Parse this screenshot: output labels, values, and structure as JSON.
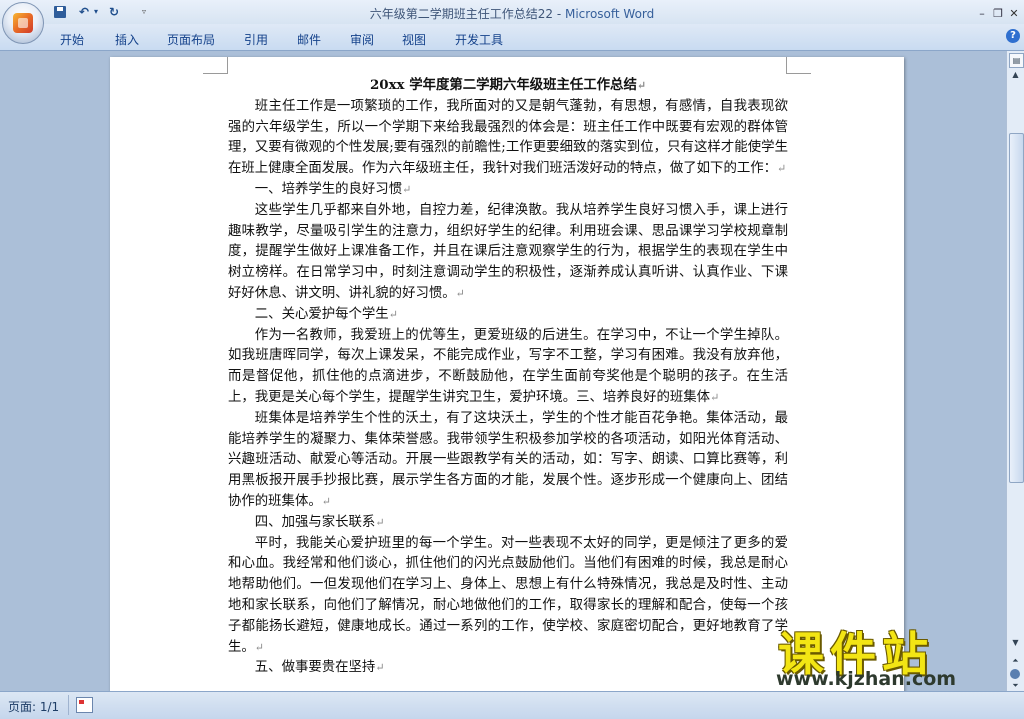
{
  "window": {
    "doc_name": "六年级第二学期班主任工作总结22",
    "separator": " - ",
    "app_name": "Microsoft Word"
  },
  "quick_access": {
    "save_icon": "save-icon",
    "undo_icon": "undo-icon",
    "redo_icon": "redo-icon"
  },
  "ribbon": {
    "tabs": [
      "开始",
      "插入",
      "页面布局",
      "引用",
      "邮件",
      "审阅",
      "视图",
      "开发工具"
    ]
  },
  "document": {
    "title": "20xx 学年度第二学期六年级班主任工作总结",
    "paragraphs": [
      "班主任工作是一项繁琐的工作，我所面对的又是朝气蓬勃，有思想，有感情，自我表现欲强的六年级学生，所以一个学期下来给我最强烈的体会是：班主任工作中既要有宏观的群体管理，又要有微观的个性发展;要有强烈的前瞻性;工作更要细致的落实到位，只有这样才能使学生在班上健康全面发展。作为六年级班主任，我针对我们班活泼好动的特点，做了如下的工作：",
      "一、培养学生的良好习惯",
      "这些学生几乎都来自外地，自控力差，纪律涣散。我从培养学生良好习惯入手，课上进行趣味教学，尽量吸引学生的注意力，组织好学生的纪律。利用班会课、思品课学习学校规章制度，提醒学生做好上课准备工作，并且在课后注意观察学生的行为，根据学生的表现在学生中树立榜样。在日常学习中，时刻注意调动学生的积极性，逐渐养成认真听讲、认真作业、下课好好休息、讲文明、讲礼貌的好习惯。",
      "二、关心爱护每个学生",
      "作为一名教师，我爱班上的优等生，更爱班级的后进生。在学习中，不让一个学生掉队。如我班唐晖同学，每次上课发呆，不能完成作业，写字不工整，学习有困难。我没有放弃他，而是督促他，抓住他的点滴进步，不断鼓励他，在学生面前夸奖他是个聪明的孩子。在生活上，我更是关心每个学生，提醒学生讲究卫生，爱护环境。三、培养良好的班集体",
      "班集体是培养学生个性的沃土，有了这块沃土，学生的个性才能百花争艳。集体活动，最能培养学生的凝聚力、集体荣誉感。我带领学生积极参加学校的各项活动，如阳光体育活动、兴趣班活动、献爱心等活动。开展一些跟教学有关的活动，如：写字、朗读、口算比赛等，利用黑板报开展手抄报比赛，展示学生各方面的才能，发展个性。逐步形成一个健康向上、团结协作的班集体。",
      "四、加强与家长联系",
      "平时，我能关心爱护班里的每一个学生。对一些表现不太好的同学，更是倾注了更多的爱和心血。我经常和他们谈心，抓住他们的闪光点鼓励他们。当他们有困难的时候，我总是耐心地帮助他们。一但发现他们在学习上、身体上、思想上有什么特殊情况，我总是及时性、主动地和家长联系，向他们了解情况，耐心地做他们的工作，取得家长的理解和配合，使每一个孩子都能扬长避短，健康地成长。通过一系列的工作，使学校、家庭密切配合，更好地教育了学生。",
      "五、做事要贵在坚持"
    ],
    "para_mark": "↵"
  },
  "status_bar": {
    "page_label": "页面: 1/1"
  },
  "watermark": {
    "text": "课件站",
    "url": "www.kjzhan.com"
  }
}
